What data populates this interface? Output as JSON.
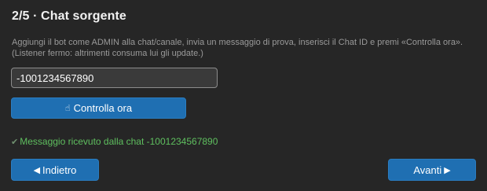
{
  "header": {
    "title": "2/5 · Chat sorgente"
  },
  "instructions": {
    "line1": "Aggiungi il bot come ADMIN alla chat/canale, invia un messaggio di prova, inserisci il Chat ID e premi «Controlla ora».",
    "line2": "(Listener fermo: altrimenti consuma lui gli update.)"
  },
  "chat_id_input": {
    "value": "-1001234567890",
    "placeholder": ""
  },
  "check_button": {
    "icon": "hand-pointer-icon",
    "icon_glyph": "☝",
    "label": "Controlla ora"
  },
  "status": {
    "icon": "checkmark-icon",
    "icon_glyph": "✔",
    "text": "Messaggio ricevuto dalla chat -1001234567890",
    "color": "#5fbf5f"
  },
  "navigation": {
    "back_arrow": "◀",
    "back_label": "Indietro",
    "next_arrow": "▶",
    "next_label": "Avanti"
  },
  "colors": {
    "background": "#262626",
    "button": "#1f6fb2",
    "success": "#5fbf5f"
  }
}
